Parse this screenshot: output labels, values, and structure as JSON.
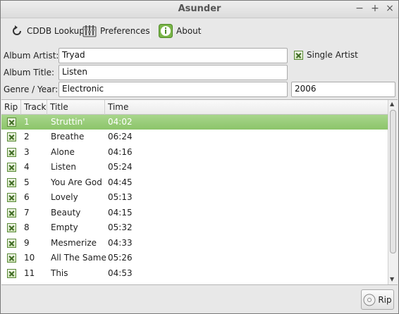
{
  "window": {
    "title": "Asunder"
  },
  "toolbar": {
    "cddb_label": "CDDB Lookup",
    "preferences_label": "Preferences",
    "about_label": "About"
  },
  "form": {
    "album_artist_label": "Album Artist:",
    "album_artist_value": "Tryad",
    "single_artist_label": "Single Artist",
    "single_artist_checked": true,
    "album_title_label": "Album Title:",
    "album_title_value": "Listen",
    "genre_year_label": "Genre / Year:",
    "genre_value": "Electronic",
    "year_value": "2006"
  },
  "tracklist": {
    "columns": [
      "Rip",
      "Track",
      "Title",
      "Time"
    ],
    "selected_index": 0,
    "rows": [
      {
        "rip": true,
        "track": "1",
        "title": "Struttin'",
        "time": "04:02"
      },
      {
        "rip": true,
        "track": "2",
        "title": "Breathe",
        "time": "06:24"
      },
      {
        "rip": true,
        "track": "3",
        "title": "Alone",
        "time": "04:16"
      },
      {
        "rip": true,
        "track": "4",
        "title": "Listen",
        "time": "05:24"
      },
      {
        "rip": true,
        "track": "5",
        "title": "You Are God",
        "time": "04:45"
      },
      {
        "rip": true,
        "track": "6",
        "title": "Lovely",
        "time": "05:13"
      },
      {
        "rip": true,
        "track": "7",
        "title": "Beauty",
        "time": "04:15"
      },
      {
        "rip": true,
        "track": "8",
        "title": "Empty",
        "time": "05:32"
      },
      {
        "rip": true,
        "track": "9",
        "title": "Mesmerize",
        "time": "04:33"
      },
      {
        "rip": true,
        "track": "10",
        "title": "All The Same",
        "time": "05:26"
      },
      {
        "rip": true,
        "track": "11",
        "title": "This",
        "time": "04:53"
      }
    ]
  },
  "footer": {
    "rip_label": "Rip"
  },
  "colors": {
    "accent": "#8cc46a",
    "check": "#3f6b24"
  }
}
